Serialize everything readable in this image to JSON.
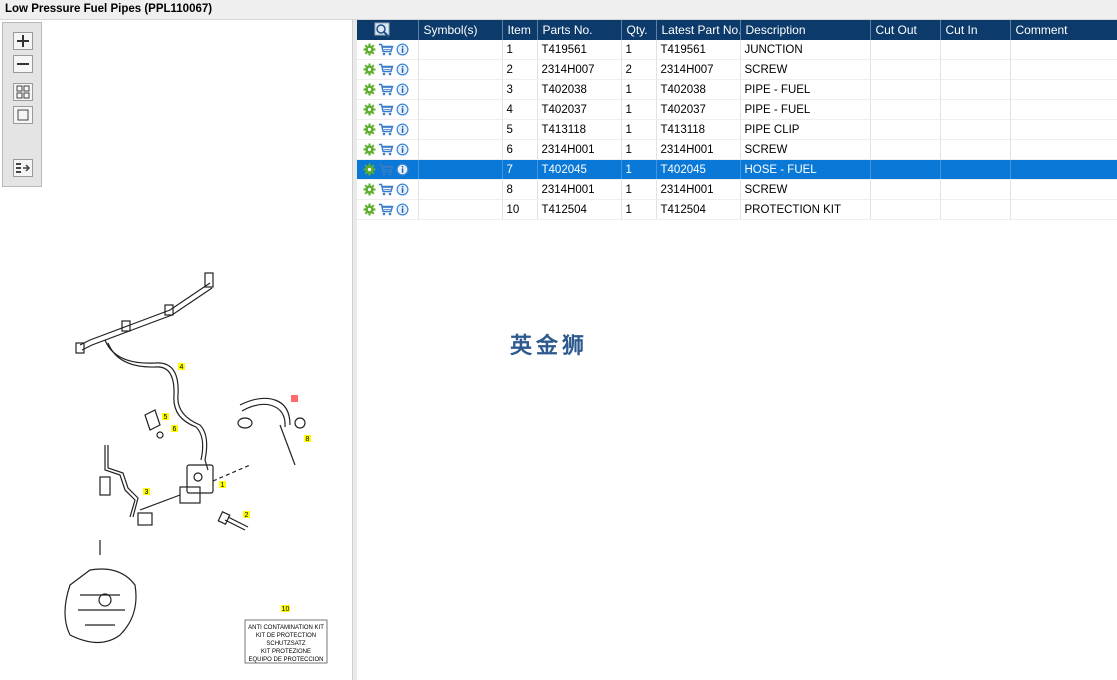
{
  "title": "Low Pressure Fuel Pipes (PPL110067)",
  "toolbar": {
    "zoom_in_icon": "zoom-in-icon",
    "zoom_out_icon": "zoom-out-icon",
    "fit_icon": "fit-all-icon",
    "actual_size_icon": "actual-size-icon",
    "list_icon": "list-export-icon"
  },
  "table": {
    "columns": [
      "",
      "Symbol(s)",
      "Item",
      "Parts No.",
      "Qty.",
      "Latest Part No.",
      "Description",
      "Cut Out",
      "Cut In",
      "Comment"
    ],
    "rows": [
      {
        "item": "1",
        "part": "T419561",
        "qty": "1",
        "latest": "T419561",
        "desc": "JUNCTION"
      },
      {
        "item": "2",
        "part": "2314H007",
        "qty": "2",
        "latest": "2314H007",
        "desc": "SCREW"
      },
      {
        "item": "3",
        "part": "T402038",
        "qty": "1",
        "latest": "T402038",
        "desc": "PIPE - FUEL"
      },
      {
        "item": "4",
        "part": "T402037",
        "qty": "1",
        "latest": "T402037",
        "desc": "PIPE - FUEL"
      },
      {
        "item": "5",
        "part": "T413118",
        "qty": "1",
        "latest": "T413118",
        "desc": "PIPE CLIP"
      },
      {
        "item": "6",
        "part": "2314H001",
        "qty": "1",
        "latest": "2314H001",
        "desc": "SCREW"
      },
      {
        "item": "7",
        "part": "T402045",
        "qty": "1",
        "latest": "T402045",
        "desc": "HOSE - FUEL"
      },
      {
        "item": "8",
        "part": "2314H001",
        "qty": "1",
        "latest": "2314H001",
        "desc": "SCREW"
      },
      {
        "item": "10",
        "part": "T412504",
        "qty": "1",
        "latest": "T412504",
        "desc": "PROTECTION KIT"
      }
    ],
    "selected_item": "7"
  },
  "watermark": "英金狮",
  "diagram": {
    "callouts": [
      "1",
      "2",
      "3",
      "4",
      "5",
      "6",
      "8",
      "10"
    ],
    "kit_label": [
      "ANTI CONTAMINATION KIT",
      "KIT DE PROTECTION",
      "SCHUTZSATZ",
      "KIT PROTEZIONE",
      "EQUIPO DE PROTECCION"
    ]
  },
  "colors": {
    "header_bg": "#0c3a6b",
    "selected_row": "#0a78d7",
    "callout_yellow": "#ffff00",
    "callout_red": "#ff6b6b"
  }
}
